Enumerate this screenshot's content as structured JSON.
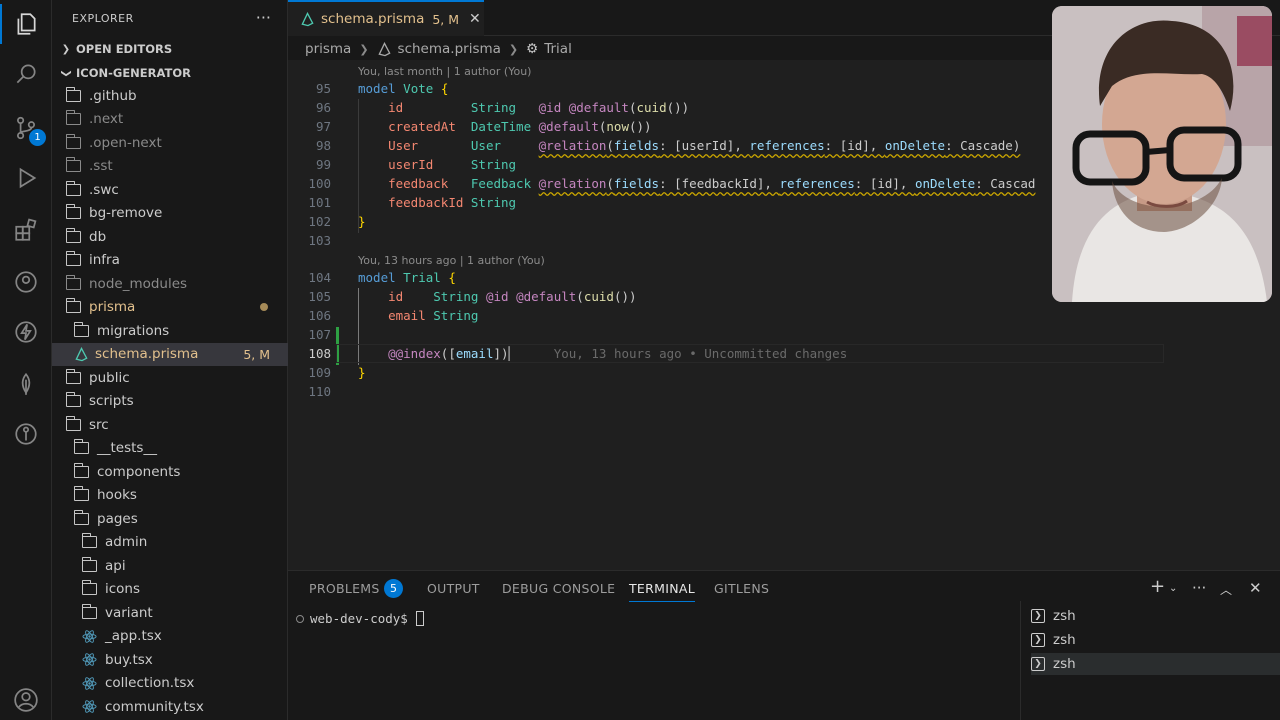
{
  "sidebar": {
    "title": "EXPLORER",
    "more": "···",
    "open_editors": "OPEN EDITORS",
    "project": "ICON-GENERATOR",
    "items": [
      {
        "label": ".github",
        "type": "folder",
        "state": "normal"
      },
      {
        "label": ".next",
        "type": "folder",
        "state": "dim"
      },
      {
        "label": ".open-next",
        "type": "folder",
        "state": "dim"
      },
      {
        "label": ".sst",
        "type": "folder",
        "state": "dim"
      },
      {
        "label": ".swc",
        "type": "folder",
        "state": "normal"
      },
      {
        "label": "bg-remove",
        "type": "folder",
        "state": "normal"
      },
      {
        "label": "db",
        "type": "folder",
        "state": "normal"
      },
      {
        "label": "infra",
        "type": "folder",
        "state": "normal"
      },
      {
        "label": "node_modules",
        "type": "folder",
        "state": "dim"
      },
      {
        "label": "prisma",
        "type": "folder",
        "state": "git"
      },
      {
        "label": "migrations",
        "type": "folder",
        "state": "normal"
      },
      {
        "label": "schema.prisma",
        "type": "prisma",
        "state": "git",
        "status": "5, M"
      },
      {
        "label": "public",
        "type": "folder",
        "state": "normal"
      },
      {
        "label": "scripts",
        "type": "folder",
        "state": "normal"
      },
      {
        "label": "src",
        "type": "folder",
        "state": "normal"
      },
      {
        "label": "__tests__",
        "type": "folder",
        "state": "normal"
      },
      {
        "label": "components",
        "type": "folder",
        "state": "normal"
      },
      {
        "label": "hooks",
        "type": "folder",
        "state": "normal"
      },
      {
        "label": "pages",
        "type": "folder",
        "state": "normal"
      },
      {
        "label": "admin",
        "type": "folder",
        "state": "normal"
      },
      {
        "label": "api",
        "type": "folder",
        "state": "normal"
      },
      {
        "label": "icons",
        "type": "folder",
        "state": "normal"
      },
      {
        "label": "variant",
        "type": "folder",
        "state": "normal"
      },
      {
        "label": "_app.tsx",
        "type": "react",
        "state": "normal"
      },
      {
        "label": "buy.tsx",
        "type": "react",
        "state": "normal"
      },
      {
        "label": "collection.tsx",
        "type": "react",
        "state": "normal"
      },
      {
        "label": "community.tsx",
        "type": "react",
        "state": "normal"
      }
    ]
  },
  "activity": {
    "source_control_badge": "1"
  },
  "editor": {
    "tab": {
      "label": "schema.prisma",
      "status": "5, M",
      "close": "✕"
    },
    "breadcrumb": [
      "prisma",
      "schema.prisma",
      "Trial"
    ],
    "codelens": [
      "You, last month | 1 author (You)",
      "You, 13 hours ago | 1 author (You)"
    ],
    "line_numbers": [
      "95",
      "96",
      "97",
      "98",
      "99",
      "100",
      "101",
      "102",
      "103",
      "104",
      "105",
      "106",
      "107",
      "108",
      "109",
      "110"
    ],
    "blame": "You, 13 hours ago • Uncommitted changes"
  },
  "panel": {
    "tabs": [
      "PROBLEMS",
      "OUTPUT",
      "DEBUG CONSOLE",
      "TERMINAL",
      "GITLENS"
    ],
    "problems_count": "5",
    "prompt": "web-dev-cody$",
    "sessions": [
      "zsh",
      "zsh",
      "zsh"
    ]
  }
}
